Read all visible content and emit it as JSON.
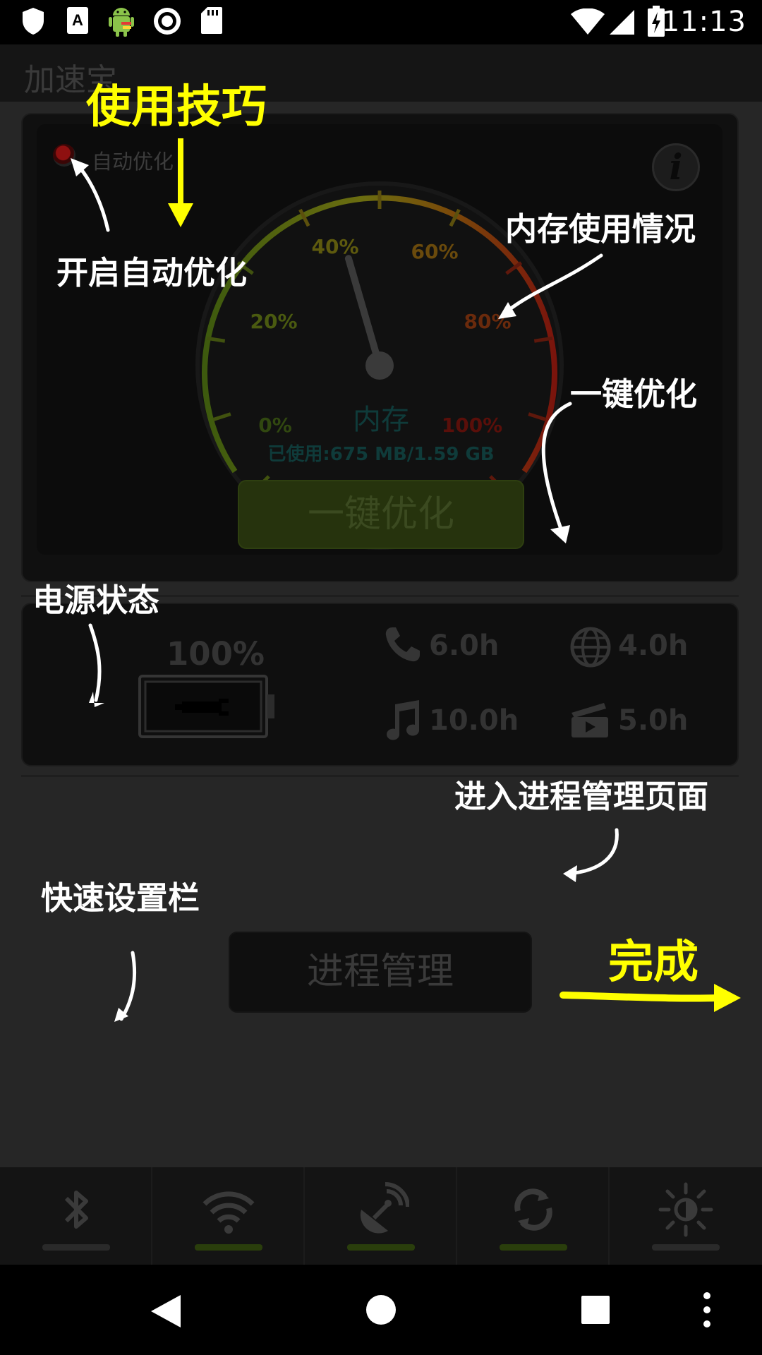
{
  "status_bar": {
    "time": "11:13",
    "left_icons": [
      "shield-icon",
      "text-a-icon",
      "android-icon",
      "record-icon",
      "sd-card-icon"
    ],
    "right_icons": [
      "wifi-icon",
      "signal-icon",
      "battery-charging-icon"
    ]
  },
  "app": {
    "title": "加速宝",
    "auto_optimize_label": "自动优化",
    "gauge": {
      "ticks": [
        "0%",
        "20%",
        "40%",
        "60%",
        "80%",
        "100%"
      ],
      "title": "内存",
      "usage": "已使用:675 MB/1.59 GB",
      "needle_percent": 40
    },
    "optimize_button": "一键优化",
    "power": {
      "battery_percent": "100%",
      "stats": [
        {
          "icon": "phone-icon",
          "value": "6.0h"
        },
        {
          "icon": "globe-icon",
          "value": "4.0h"
        },
        {
          "icon": "music-icon",
          "value": "10.0h"
        },
        {
          "icon": "video-icon",
          "value": "5.0h"
        }
      ]
    },
    "process_button": "进程管理",
    "quick_settings": [
      {
        "icon": "bluetooth-icon",
        "on": false
      },
      {
        "icon": "wifi-icon",
        "on": true
      },
      {
        "icon": "gps-icon",
        "on": true
      },
      {
        "icon": "sync-icon",
        "on": true
      },
      {
        "icon": "brightness-icon",
        "on": false
      }
    ]
  },
  "tutorial": {
    "title": "使用技巧",
    "auto_optimize": "开启自动优化",
    "memory_usage": "内存使用情况",
    "one_key": "一键优化",
    "power_status": "电源状态",
    "process_page": "进入进程管理页面",
    "quick_bar": "快速设置栏",
    "done": "完成"
  },
  "colors": {
    "tutorial_highlight": "#ffff00",
    "gauge_green": "#5a7a12",
    "gauge_red": "#8a1a0e"
  }
}
